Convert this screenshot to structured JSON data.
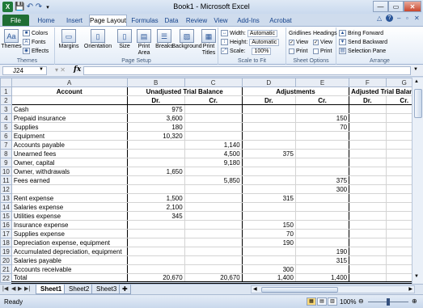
{
  "window": {
    "title": "Book1 - Microsoft Excel",
    "app_icon": "X",
    "minimize": "—",
    "maximize": "▭",
    "close": "✕"
  },
  "quick_access": {
    "save": "💾",
    "undo": "↶",
    "redo": "↷",
    "more": "▾"
  },
  "tabs": [
    "File",
    "Home",
    "Insert",
    "Page Layout",
    "Formulas",
    "Data",
    "Review",
    "View",
    "Add-Ins",
    "Acrobat"
  ],
  "ribbon": {
    "themes": {
      "themes_label": "Themes",
      "colors": "Colors",
      "fonts": "Fonts",
      "effects": "Effects",
      "group": "Themes"
    },
    "page_setup": {
      "margins": "Margins",
      "orientation": "Orientation",
      "size": "Size",
      "print_area": "Print Area",
      "breaks": "Breaks",
      "background": "Background",
      "print_titles": "Print Titles",
      "group": "Page Setup"
    },
    "scale_to_fit": {
      "width_label": "Width:",
      "width_value": "Automatic",
      "height_label": "Height:",
      "height_value": "Automatic",
      "scale_label": "Scale:",
      "scale_value": "100%",
      "group": "Scale to Fit"
    },
    "sheet_options": {
      "gridlines": "Gridlines",
      "headings": "Headings",
      "view": "View",
      "print": "Print",
      "group": "Sheet Options"
    },
    "arrange": {
      "bring_forward": "Bring Forward",
      "send_backward": "Send Backward",
      "selection_pane": "Selection Pane",
      "group": "Arrange"
    }
  },
  "formula_bar": {
    "name_box": "J24",
    "fx": "fx",
    "formula": ""
  },
  "columns": [
    "A",
    "B",
    "C",
    "D",
    "E",
    "F",
    "G"
  ],
  "headers": {
    "account": "Account",
    "unadjusted": "Unadjusted Trial Balance",
    "adjustments": "Adjustments",
    "adjusted": "Adjusted Trial Balance",
    "dr": "Dr.",
    "cr": "Cr."
  },
  "rows": [
    {
      "n": "3",
      "account": "Cash",
      "b": "975",
      "c": "",
      "d": "",
      "e": ""
    },
    {
      "n": "4",
      "account": "Prepaid insurance",
      "b": "3,600",
      "c": "",
      "d": "",
      "e": "150"
    },
    {
      "n": "5",
      "account": "Supplies",
      "b": "180",
      "c": "",
      "d": "",
      "e": "70"
    },
    {
      "n": "6",
      "account": "Equipment",
      "b": "10,320",
      "c": "",
      "d": "",
      "e": ""
    },
    {
      "n": "7",
      "account": "Accounts payable",
      "b": "",
      "c": "1,140",
      "d": "",
      "e": ""
    },
    {
      "n": "8",
      "account": "Unearned fees",
      "b": "",
      "c": "4,500",
      "d": "375",
      "e": ""
    },
    {
      "n": "9",
      "account": "Owner, capital",
      "b": "",
      "c": "9,180",
      "d": "",
      "e": ""
    },
    {
      "n": "10",
      "account": "Owner, withdrawals",
      "b": "1,650",
      "c": "",
      "d": "",
      "e": ""
    },
    {
      "n": "11",
      "account": "Fees earned",
      "b": "",
      "c": "5,850",
      "d": "",
      "e": "375"
    },
    {
      "n": "12",
      "account": "",
      "b": "",
      "c": "",
      "d": "",
      "e": "300"
    },
    {
      "n": "13",
      "account": "Rent expense",
      "b": "1,500",
      "c": "",
      "d": "315",
      "e": ""
    },
    {
      "n": "14",
      "account": "Salaries expense",
      "b": "2,100",
      "c": "",
      "d": "",
      "e": ""
    },
    {
      "n": "15",
      "account": "Utilities expense",
      "b": "345",
      "c": "",
      "d": "",
      "e": ""
    },
    {
      "n": "16",
      "account": "Insurance expense",
      "b": "",
      "c": "",
      "d": "150",
      "e": ""
    },
    {
      "n": "17",
      "account": "Supplies expense",
      "b": "",
      "c": "",
      "d": "70",
      "e": ""
    },
    {
      "n": "18",
      "account": "Depreciation expense, equipment",
      "b": "",
      "c": "",
      "d": "190",
      "e": ""
    },
    {
      "n": "19",
      "account": "Accumulated depreciation, equipment",
      "b": "",
      "c": "",
      "d": "",
      "e": "190"
    },
    {
      "n": "20",
      "account": "Salaries payable",
      "b": "",
      "c": "",
      "d": "",
      "e": "315"
    },
    {
      "n": "21",
      "account": "Accounts receivable",
      "b": "",
      "c": "",
      "d": "300",
      "e": ""
    },
    {
      "n": "22",
      "account": "Total",
      "b": "20,670",
      "c": "20,670",
      "d": "1,400",
      "e": "1,400"
    }
  ],
  "sheet_tabs": [
    "Sheet1",
    "Sheet2",
    "Sheet3"
  ],
  "status": {
    "ready": "Ready",
    "zoom": "100%"
  }
}
